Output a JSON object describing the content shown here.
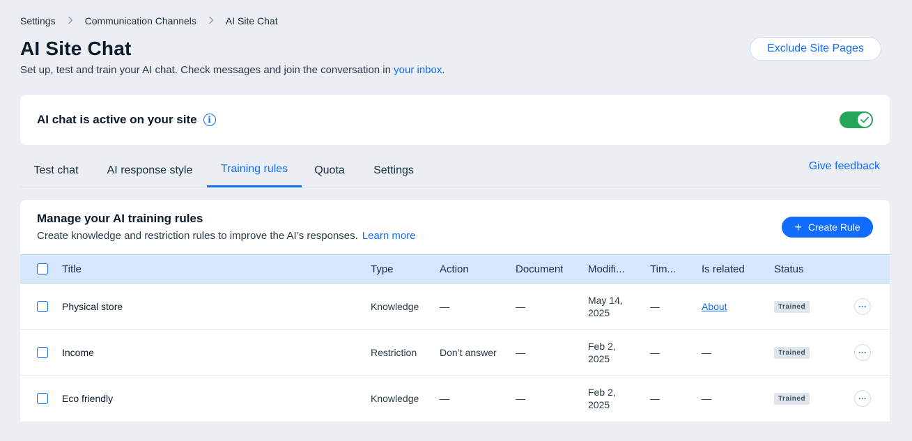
{
  "breadcrumb": [
    "Settings",
    "Communication Channels",
    "AI Site Chat"
  ],
  "header": {
    "title": "AI Site Chat",
    "subtitle_prefix": "Set up, test and train your AI chat. Check messages and join the conversation in ",
    "subtitle_link": "your inbox",
    "subtitle_suffix": ".",
    "exclude_button": "Exclude Site Pages"
  },
  "status_card": {
    "label": "AI chat is active on your site",
    "info_icon": "i",
    "toggle_on": true,
    "toggle_color": "#25a55a"
  },
  "tabs": {
    "items": [
      "Test chat",
      "AI response style",
      "Training rules",
      "Quota",
      "Settings"
    ],
    "active": "Training rules",
    "feedback": "Give feedback"
  },
  "rules": {
    "title": "Manage your AI training rules",
    "description": "Create knowledge and restriction rules to improve the AI’s responses.",
    "learn_more": "Learn more",
    "create_button": "Create Rule",
    "create_icon": "+",
    "columns": [
      "Title",
      "Type",
      "Action",
      "Document",
      "Modifi...",
      "Tim...",
      "Is related",
      "Status"
    ],
    "rows": [
      {
        "title": "Physical store",
        "type": "Knowledge",
        "action": "—",
        "document": "—",
        "modified": "May 14, 2025",
        "time": "—",
        "related": "About",
        "status": "Trained"
      },
      {
        "title": "Income",
        "type": "Restriction",
        "action": "Don’t answer",
        "document": "—",
        "modified": "Feb 2, 2025",
        "time": "—",
        "related": "—",
        "status": "Trained"
      },
      {
        "title": "Eco friendly",
        "type": "Knowledge",
        "action": "—",
        "document": "—",
        "modified": "Feb 2, 2025",
        "time": "—",
        "related": "—",
        "status": "Trained"
      }
    ],
    "more_icon": "···"
  },
  "colors": {
    "accent": "#116dff",
    "background": "#ebeef3",
    "header_row": "#d6e6fe",
    "success": "#25a55a"
  }
}
